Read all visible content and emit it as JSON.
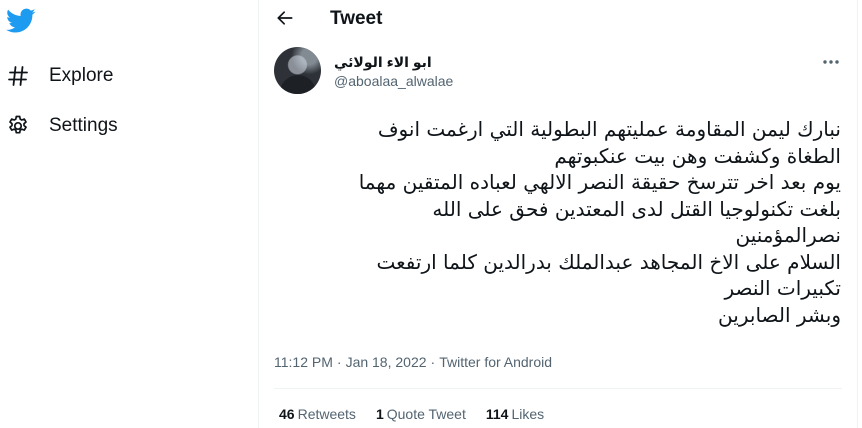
{
  "sidebar": {
    "logo": "twitter-bird-icon",
    "items": [
      {
        "label": "Explore",
        "icon": "hashtag-icon"
      },
      {
        "label": "Settings",
        "icon": "gear-icon"
      }
    ]
  },
  "header": {
    "title": "Tweet",
    "back_icon": "arrow-left-icon"
  },
  "tweet": {
    "author": {
      "display_name": "ابو الاء الولائي",
      "handle": "@aboalaa_alwalae"
    },
    "text_lines": [
      "نبارك ليمن المقاومة عمليتهم البطولية التي ارغمت انوف",
      "الطغاة وكشفت وهن بيت عنكبوتهم",
      "يوم بعد اخر تترسخ حقيقة النصر الالهي لعباده المتقين مهما",
      "بلغت تكنولوجيا القتل لدى المعتدين فحق على الله",
      "نصرالمؤمنين",
      "السلام على الاخ المجاهد عبدالملك بدرالدين كلما ارتفعت",
      "تكبيرات النصر",
      "وبشر الصابرين"
    ],
    "time": "11:12 PM",
    "separator1": "·",
    "date": "Jan 18, 2022",
    "separator2": "·",
    "source": "Twitter for Android",
    "stats": {
      "retweets": {
        "count": "46",
        "label": "Retweets"
      },
      "quotes": {
        "count": "1",
        "label": "Quote Tweet"
      },
      "likes": {
        "count": "114",
        "label": "Likes"
      }
    }
  },
  "colors": {
    "brand": "#1d9bf0",
    "text": "#0f1419",
    "secondary": "#536471",
    "border": "#eff3f4"
  }
}
